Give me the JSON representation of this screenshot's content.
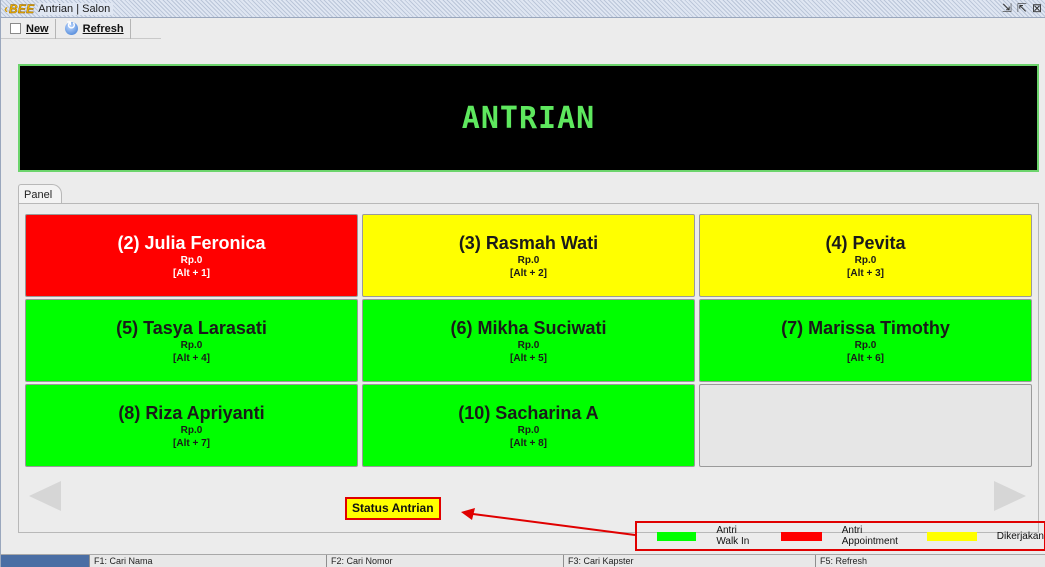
{
  "window": {
    "title": "Antrian | Salon",
    "logo_text": "BEE"
  },
  "toolbar": {
    "new_label": "New",
    "refresh_label": "Refresh"
  },
  "banner": {
    "text": "ANTRIAN"
  },
  "panel": {
    "tab_label": "Panel"
  },
  "queue": [
    {
      "name": "(2) Julia Feronica",
      "amount": "Rp.0",
      "shortcut": "[Alt + 1]",
      "status": "appointment"
    },
    {
      "name": "(3) Rasmah Wati",
      "amount": "Rp.0",
      "shortcut": "[Alt + 2]",
      "status": "dikerjakan"
    },
    {
      "name": "(4) Pevita",
      "amount": "Rp.0",
      "shortcut": "[Alt + 3]",
      "status": "dikerjakan"
    },
    {
      "name": "(5) Tasya Larasati",
      "amount": "Rp.0",
      "shortcut": "[Alt + 4]",
      "status": "walkin"
    },
    {
      "name": "(6) Mikha Suciwati",
      "amount": "Rp.0",
      "shortcut": "[Alt + 5]",
      "status": "walkin"
    },
    {
      "name": "(7) Marissa Timothy",
      "amount": "Rp.0",
      "shortcut": "[Alt + 6]",
      "status": "walkin"
    },
    {
      "name": "(8) Riza Apriyanti",
      "amount": "Rp.0",
      "shortcut": "[Alt + 7]",
      "status": "walkin"
    },
    {
      "name": "(10) Sacharina A",
      "amount": "Rp.0",
      "shortcut": "[Alt + 8]",
      "status": "walkin"
    }
  ],
  "status_annotation": {
    "label": "Status Antrian"
  },
  "legend": [
    {
      "label": "Antri Walk In",
      "color": "#00ff00"
    },
    {
      "label": "Antri Appointment",
      "color": "#ff0000"
    },
    {
      "label": "Dikerjakan",
      "color": "#ffff00"
    }
  ],
  "statusbar": [
    "F1: Cari Nama",
    "F2: Cari Nomor",
    "F3: Cari Kapster",
    "F5: Refresh"
  ],
  "colors": {
    "walkin": "#00ff00",
    "appointment": "#ff0000",
    "dikerjakan": "#ffff00",
    "banner_text": "#5ee85e"
  }
}
